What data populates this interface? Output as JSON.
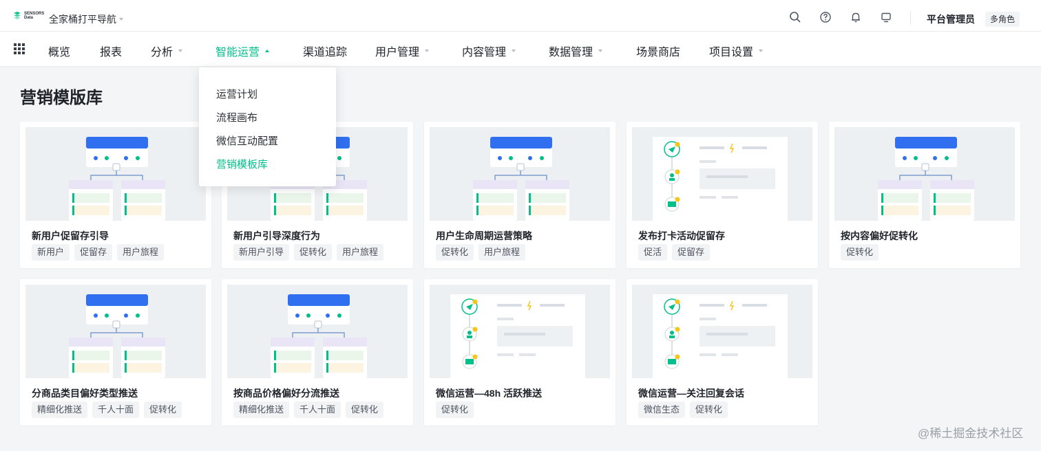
{
  "topbar": {
    "logo_text": [
      "SENSORS",
      "Data"
    ],
    "workspace": "全家桶打平导航",
    "icons": [
      "search-icon",
      "help-icon",
      "bell-icon",
      "monitor-icon"
    ],
    "user_name": "平台管理员",
    "role_badge": "多角色"
  },
  "nav": {
    "items": [
      {
        "label": "概览",
        "dropdown": false
      },
      {
        "label": "报表",
        "dropdown": false
      },
      {
        "label": "分析",
        "dropdown": true
      },
      {
        "label": "智能运营",
        "dropdown": true,
        "active": true
      },
      {
        "label": "渠道追踪",
        "dropdown": false
      },
      {
        "label": "用户管理",
        "dropdown": true
      },
      {
        "label": "内容管理",
        "dropdown": true
      },
      {
        "label": "数据管理",
        "dropdown": true
      },
      {
        "label": "场景商店",
        "dropdown": false
      },
      {
        "label": "项目设置",
        "dropdown": true
      }
    ]
  },
  "dropdown": {
    "items": [
      "运营计划",
      "流程画布",
      "微信互动配置",
      "营销模板库"
    ],
    "active_index": 3
  },
  "main": {
    "title": "营销模版库",
    "cards": [
      {
        "title": "新用户促留存引导",
        "tags": [
          "新用户",
          "促留存",
          "用户旅程"
        ],
        "thumb": "flow"
      },
      {
        "title": "新用户引导深度行为",
        "tags": [
          "新用户引导",
          "促转化",
          "用户旅程"
        ],
        "thumb": "flow"
      },
      {
        "title": "用户生命周期运营策略",
        "tags": [
          "促转化",
          "用户旅程"
        ],
        "thumb": "flow"
      },
      {
        "title": "发布打卡活动促留存",
        "tags": [
          "促活",
          "促留存"
        ],
        "thumb": "wechat"
      },
      {
        "title": "按内容偏好促转化",
        "tags": [
          "促转化"
        ],
        "thumb": "flow"
      },
      {
        "title": "分商品类目偏好类型推送",
        "tags": [
          "精细化推送",
          "千人十面",
          "促转化"
        ],
        "thumb": "flow"
      },
      {
        "title": "按商品价格偏好分流推送",
        "tags": [
          "精细化推送",
          "千人十面",
          "促转化"
        ],
        "thumb": "flow"
      },
      {
        "title": "微信运营—48h 活跃推送",
        "tags": [
          "促转化"
        ],
        "thumb": "wechat"
      },
      {
        "title": "微信运营—关注回复会话",
        "tags": [
          "微信生态",
          "促转化"
        ],
        "thumb": "wechat"
      }
    ]
  },
  "watermark": "@稀土掘金技术社区",
  "colors": {
    "accent": "#00bf8a",
    "flow_header": "#2f6ff0",
    "page_bg": "#f4f5f7"
  }
}
